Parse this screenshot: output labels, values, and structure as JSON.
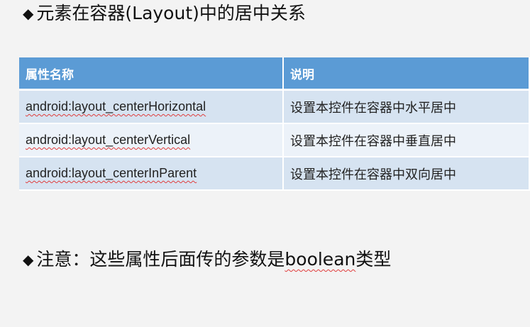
{
  "heading": {
    "bullet": "◆",
    "text": "元素在容器(Layout)中的居中关系"
  },
  "table": {
    "headers": [
      "属性名称",
      "说明"
    ],
    "rows": [
      {
        "attr": "android:layout_centerHorizontal",
        "desc": "设置本控件在容器中水平居中"
      },
      {
        "attr": "android:layout_centerVertical",
        "desc": "设置本控件在容器中垂直居中"
      },
      {
        "attr": "android:layout_centerInParent",
        "desc": "设置本控件在容器中双向居中"
      }
    ]
  },
  "note": {
    "bullet": "◆",
    "prefix": "注意：这些属性后面传的参数是",
    "keyword": "boolean",
    "suffix": "类型"
  },
  "colors": {
    "header_bg": "#5b9bd5",
    "row_odd_bg": "#d6e3f1",
    "row_even_bg": "#ecf2f9",
    "spellcheck_underline": "#e03c3c"
  }
}
